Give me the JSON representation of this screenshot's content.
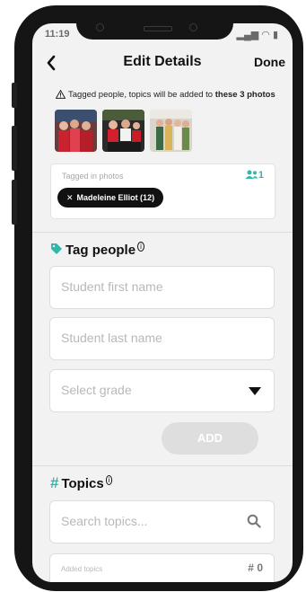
{
  "status": {
    "time": "11:19"
  },
  "header": {
    "title": "Edit Details",
    "done_label": "Done"
  },
  "notice": {
    "text": "Tagged people, topics will be added to ",
    "bold": "these 3 photos"
  },
  "tagged": {
    "label": "Tagged in photos",
    "count": "1",
    "chip": "Madeleine Elliot (12)"
  },
  "tag_people": {
    "title": "Tag people",
    "first_name_placeholder": "Student first name",
    "last_name_placeholder": "Student last name",
    "grade_placeholder": "Select grade",
    "add_label": "ADD"
  },
  "topics": {
    "title": "Topics",
    "search_placeholder": "Search topics...",
    "added_label": "Added topics",
    "added_count": "0"
  },
  "colors": {
    "accent": "#2eb8a8",
    "chip_bg": "#111111",
    "add_disabled": "#dedede"
  }
}
